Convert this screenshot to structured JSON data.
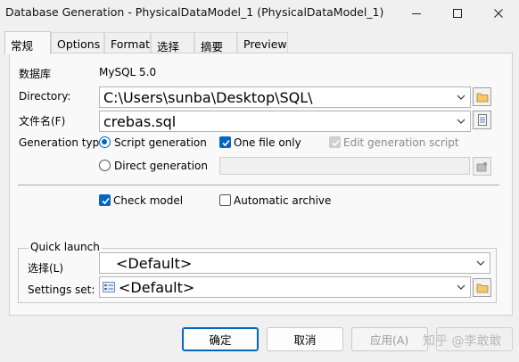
{
  "window": {
    "title": "Database Generation - PhysicalDataModel_1 (PhysicalDataModel_1)"
  },
  "tabs": [
    "常规",
    "Options",
    "Format",
    "选择",
    "摘要",
    "Preview"
  ],
  "general": {
    "dbms_label": "数据库",
    "dbms_value": "MySQL 5.0",
    "directory_label": "Directory:",
    "directory_value": "C:\\Users\\sunba\\Desktop\\SQL\\",
    "filename_label": "文件名(F)",
    "filename_value": "crebas.sql",
    "gen_type_label": "Generation type:",
    "script_generation": "Script generation",
    "direct_generation": "Direct generation",
    "one_file_only": "One file only",
    "edit_generation_script": "Edit generation script",
    "check_model": "Check model",
    "automatic_archive": "Automatic archive"
  },
  "quick_launch": {
    "legend": "Quick launch",
    "selection_label": "选择(L)",
    "selection_value": "<Default>",
    "settings_label": "Settings set:",
    "settings_value": "<Default>"
  },
  "buttons": {
    "ok": "确定",
    "cancel": "取消",
    "apply": "应用(A)"
  },
  "watermark": "知乎 @李敢敢"
}
